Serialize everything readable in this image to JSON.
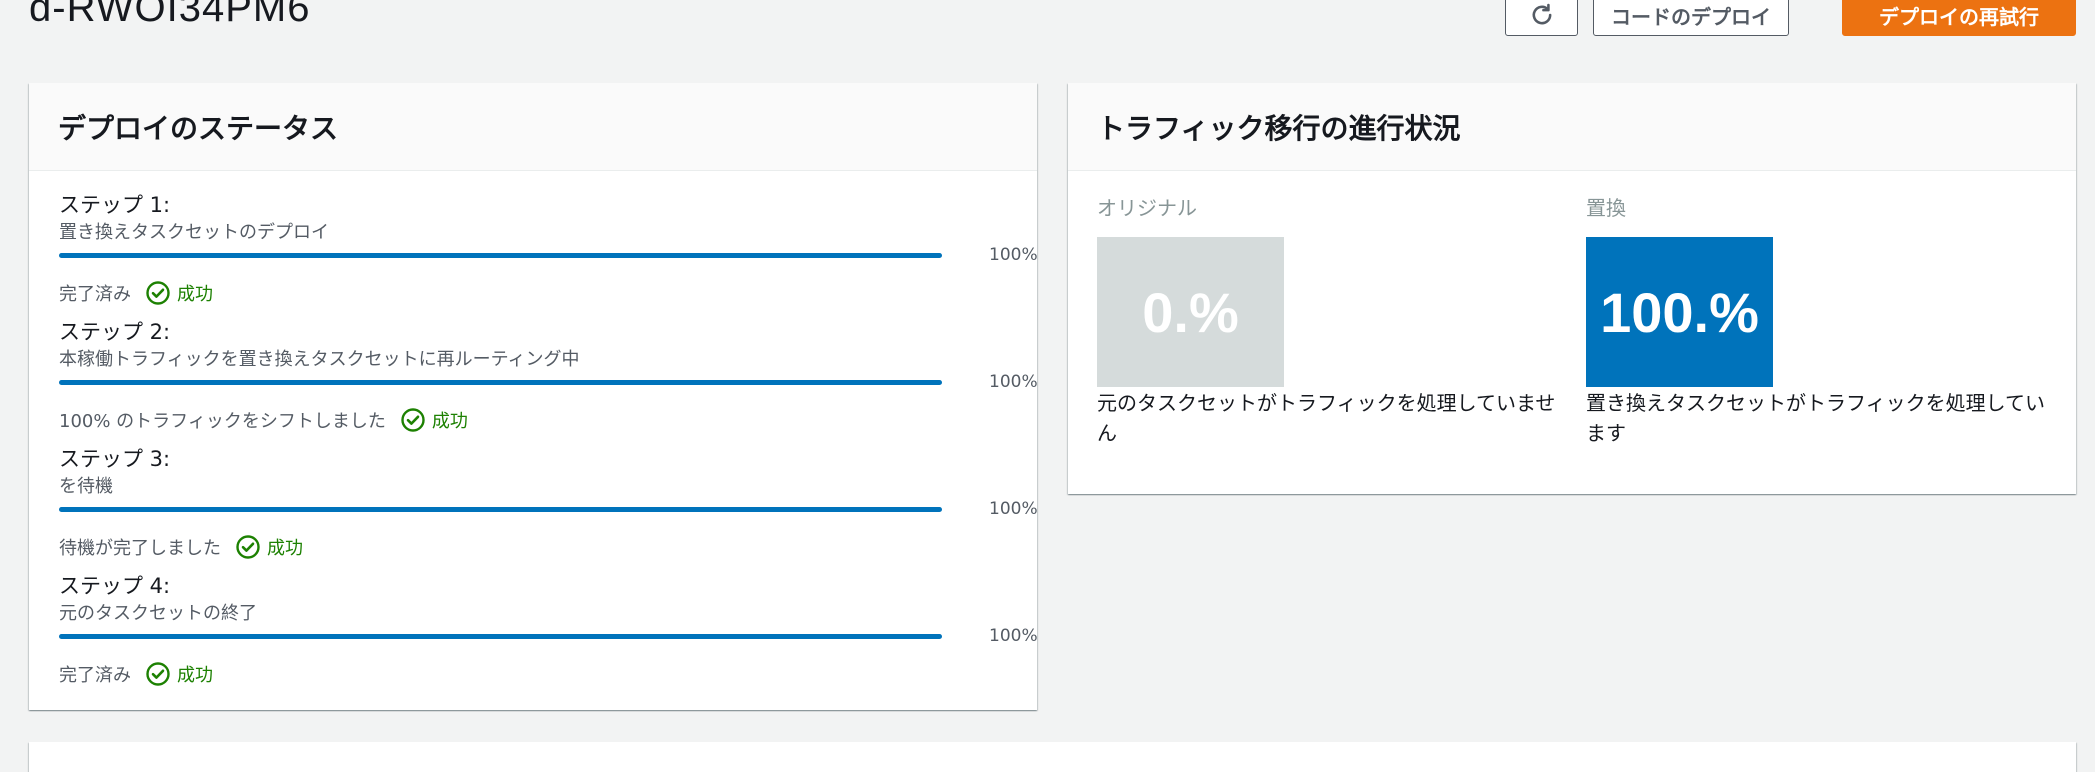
{
  "header": {
    "title": "d-RWOI34PM6",
    "buttons": {
      "refresh_icon": "refresh-icon",
      "code_deploy_label": "コードのデプロイ",
      "retry_label": "デプロイの再試行"
    }
  },
  "status_panel": {
    "title": "デプロイのステータス",
    "steps": [
      {
        "title": "ステップ 1:",
        "description": "置き換えタスクセットのデプロイ",
        "progress_percent": 100,
        "progress_label": "100%",
        "status_text": "完了済み",
        "result": "成功"
      },
      {
        "title": "ステップ 2:",
        "description": "本稼働トラフィックを置き換えタスクセットに再ルーティング中",
        "progress_percent": 100,
        "progress_label": "100%",
        "status_text": "100% のトラフィックをシフトしました",
        "result": "成功"
      },
      {
        "title": "ステップ 3:",
        "description": "を待機",
        "progress_percent": 100,
        "progress_label": "100%",
        "status_text": "待機が完了しました",
        "result": "成功"
      },
      {
        "title": "ステップ 4:",
        "description": "元のタスクセットの終了",
        "progress_percent": 100,
        "progress_label": "100%",
        "status_text": "完了済み",
        "result": "成功"
      }
    ]
  },
  "traffic_panel": {
    "title": "トラフィック移行の進行状況",
    "original": {
      "label": "オリジナル",
      "value": "0.%",
      "description": "元のタスクセットがトラフィックを処理していません",
      "color": "#d5dbdb"
    },
    "replacement": {
      "label": "置換",
      "value": "100.%",
      "description": "置き換えタスクセットがトラフィックを処理しています",
      "color": "#0073bb"
    }
  },
  "colors": {
    "accent_orange": "#ec7211",
    "progress_blue": "#0073bb",
    "success_green": "#1d8102"
  }
}
